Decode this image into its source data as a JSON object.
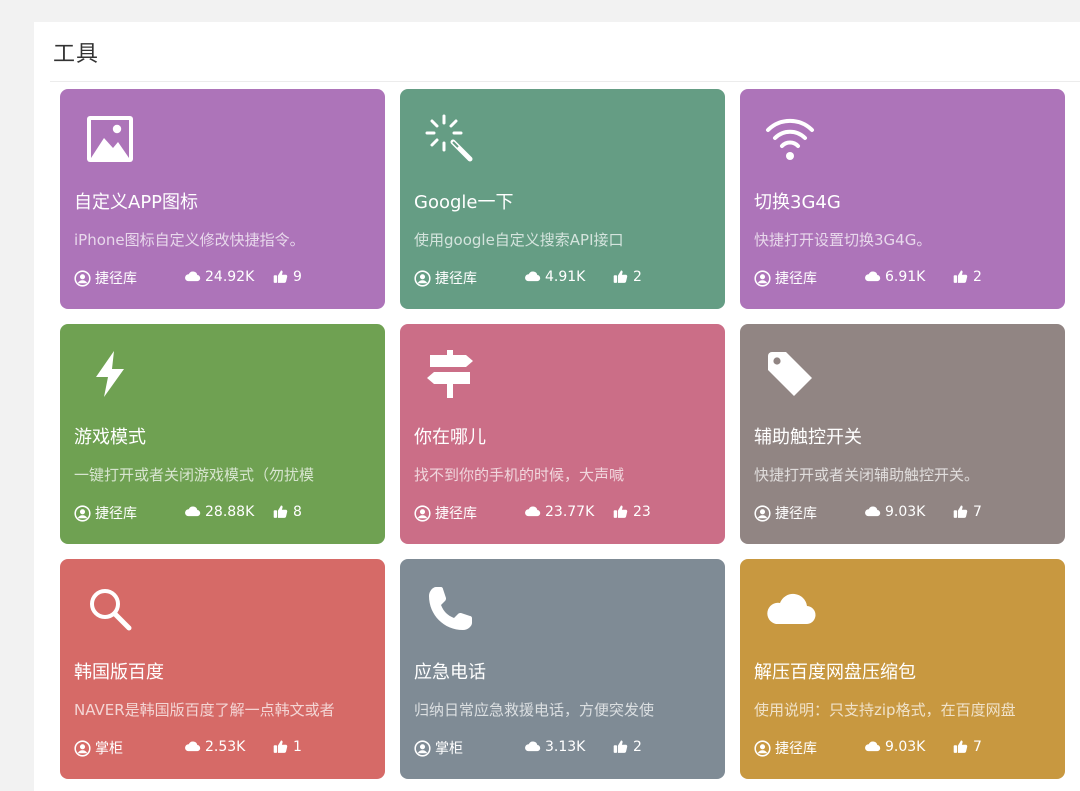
{
  "section": {
    "title": "工具"
  },
  "cards": [
    {
      "title": "自定义APP图标",
      "desc": "iPhone图标自定义修改快捷指令。",
      "author": "捷径库",
      "downloads": "24.92K",
      "likes": "9",
      "color": "#ad74b9",
      "icon": "image-icon"
    },
    {
      "title": "Google一下",
      "desc": "使用google自定义搜索API接口",
      "author": "捷径库",
      "downloads": "4.91K",
      "likes": "2",
      "color": "#659d84",
      "icon": "magic-wand-icon"
    },
    {
      "title": "切换3G4G",
      "desc": "快捷打开设置切换3G4G。",
      "author": "捷径库",
      "downloads": "6.91K",
      "likes": "2",
      "color": "#ad74b9",
      "icon": "wifi-icon"
    },
    {
      "title": "游戏模式",
      "desc": "一键打开或者关闭游戏模式（勿扰模",
      "author": "捷径库",
      "downloads": "28.88K",
      "likes": "8",
      "color": "#6fa152",
      "icon": "bolt-icon"
    },
    {
      "title": "你在哪儿",
      "desc": "找不到你的手机的时候，大声喊",
      "author": "捷径库",
      "downloads": "23.77K",
      "likes": "23",
      "color": "#cb6e87",
      "icon": "signpost-icon"
    },
    {
      "title": "辅助触控开关",
      "desc": "快捷打开或者关闭辅助触控开关。",
      "author": "捷径库",
      "downloads": "9.03K",
      "likes": "7",
      "color": "#918583",
      "icon": "tag-icon"
    },
    {
      "title": "韩国版百度",
      "desc": "NAVER是韩国版百度了解一点韩文或者",
      "author": "掌柜",
      "downloads": "2.53K",
      "likes": "1",
      "color": "#d66a67",
      "icon": "search-icon"
    },
    {
      "title": "应急电话",
      "desc": "归纳日常应急救援电话，方便突发使",
      "author": "掌柜",
      "downloads": "3.13K",
      "likes": "2",
      "color": "#7f8b95",
      "icon": "phone-icon"
    },
    {
      "title": "解压百度网盘压缩包",
      "desc": "使用说明：只支持zip格式，在百度网盘",
      "author": "捷径库",
      "downloads": "9.03K",
      "likes": "7",
      "color": "#c89840",
      "icon": "cloud-icon"
    }
  ]
}
